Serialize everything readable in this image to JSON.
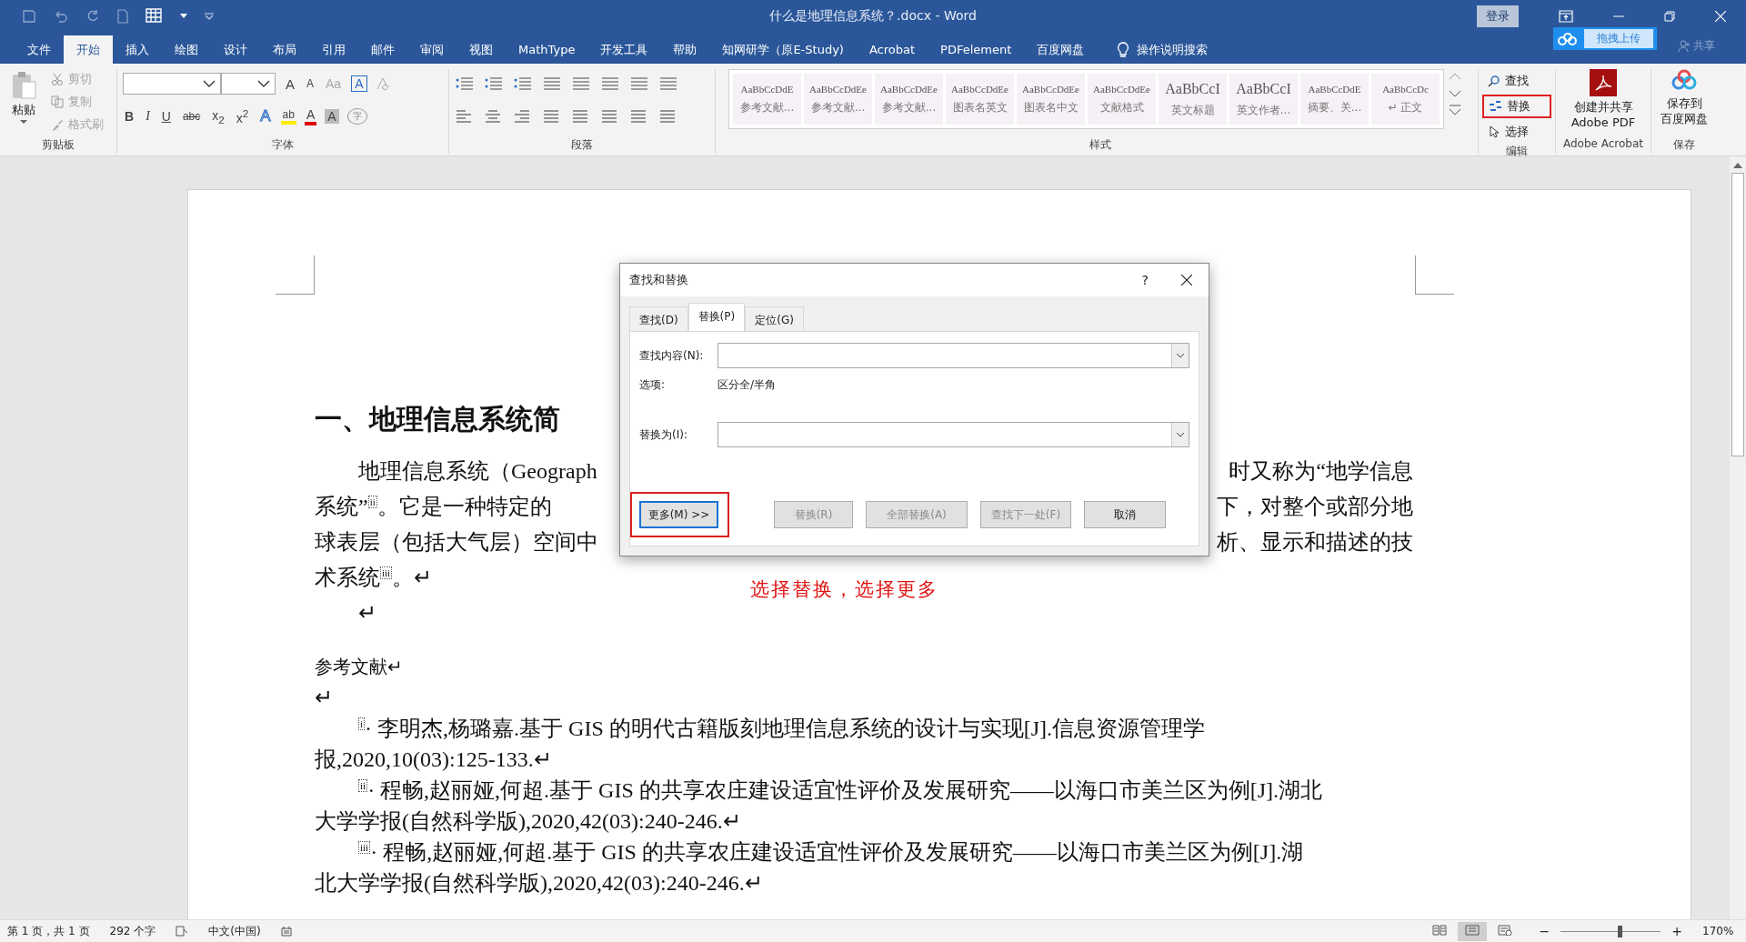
{
  "window": {
    "title": "什么是地理信息系统？.docx  -  Word",
    "login": "登录",
    "upload": "拖拽上传",
    "share": "共享"
  },
  "menu_tabs": [
    {
      "label": "文件",
      "selected": false
    },
    {
      "label": "开始",
      "selected": true
    },
    {
      "label": "插入",
      "selected": false
    },
    {
      "label": "绘图",
      "selected": false
    },
    {
      "label": "设计",
      "selected": false
    },
    {
      "label": "布局",
      "selected": false
    },
    {
      "label": "引用",
      "selected": false
    },
    {
      "label": "邮件",
      "selected": false
    },
    {
      "label": "审阅",
      "selected": false
    },
    {
      "label": "视图",
      "selected": false
    },
    {
      "label": "MathType",
      "selected": false
    },
    {
      "label": "开发工具",
      "selected": false
    },
    {
      "label": "帮助",
      "selected": false
    },
    {
      "label": "知网研学（原E-Study)",
      "selected": false
    },
    {
      "label": "Acrobat",
      "selected": false
    },
    {
      "label": "PDFelement",
      "selected": false
    },
    {
      "label": "百度网盘",
      "selected": false
    }
  ],
  "tell_me": "操作说明搜索",
  "ribbon": {
    "clipboard": {
      "paste": "粘贴",
      "label": "剪贴板",
      "items": [
        {
          "label": "剪切",
          "kind": "cut",
          "disabled": true
        },
        {
          "label": "复制",
          "kind": "copy",
          "disabled": true
        },
        {
          "label": "格式刷",
          "kind": "brush",
          "disabled": true
        }
      ]
    },
    "font": {
      "label": "字体",
      "row1": [
        {
          "label": "A",
          "kind": "grow"
        },
        {
          "label": "A",
          "kind": "shrink"
        },
        {
          "label": "Aa",
          "kind": "case"
        },
        {
          "label": "A",
          "kind": "boxed"
        }
      ],
      "row2": [
        {
          "label": "B",
          "kind": "bold"
        },
        {
          "label": "I",
          "kind": "italic"
        },
        {
          "label": "U",
          "kind": "underline"
        },
        {
          "label": "abc",
          "kind": "strike"
        },
        {
          "label": "x$_{2}$",
          "kind": "plain"
        },
        {
          "label": "x$^{2}$",
          "kind": "plain"
        },
        {
          "label": "A",
          "kind": "effect"
        },
        {
          "label": "ab",
          "kind": "highlight"
        },
        {
          "label": "A",
          "kind": "color"
        },
        {
          "label": "A",
          "kind": "shaded"
        },
        {
          "label": "字",
          "kind": "circled"
        }
      ]
    },
    "paragraph": {
      "label": "段落"
    },
    "styles": {
      "label": "样式",
      "tiles": [
        {
          "preview": "AaBbCcDdE",
          "name": "参考文献..."
        },
        {
          "preview": "AaBbCcDdEe",
          "name": "参考文献..."
        },
        {
          "preview": "AaBbCcDdEe",
          "name": "参考文献..."
        },
        {
          "preview": "AaBbCcDdEe",
          "name": "图表名英文"
        },
        {
          "preview": "AaBbCcDdEe",
          "name": "图表名中文"
        },
        {
          "preview": "AaBbCcDdEe",
          "name": "文献格式"
        },
        {
          "preview": "AaBbCcI",
          "name": "英文标题"
        },
        {
          "preview": "AaBbCcI",
          "name": "英文作者..."
        },
        {
          "preview": "AaBbCcDdE",
          "name": "摘要、关..."
        },
        {
          "preview": "AaBbCcDc",
          "name": "↵ 正文"
        }
      ]
    },
    "editing": {
      "label": "编辑",
      "items": [
        {
          "label": "查找",
          "kind": "find",
          "highlighted": false
        },
        {
          "label": "替换",
          "kind": "replace",
          "highlighted": true
        },
        {
          "label": "选择",
          "kind": "select",
          "highlighted": false
        }
      ]
    },
    "acrobat": {
      "button": [
        "创建并共享",
        "Adobe PDF"
      ],
      "label": "Adobe Acrobat"
    },
    "baidu": {
      "button": [
        "保存到",
        "百度网盘"
      ],
      "label": "保存"
    }
  },
  "document": {
    "heading": "一、地理信息系统简",
    "lines": [
      {
        "indent": true,
        "left": [
          {
            "kind": "text",
            "text": "地理信息系统（Geograph"
          }
        ],
        "right": "时又称为“地学信息"
      },
      {
        "indent": false,
        "left": [
          {
            "kind": "text",
            "text": "系统”"
          },
          {
            "kind": "marker",
            "text": "ii"
          },
          {
            "kind": "text",
            "text": "。它是一种特定的"
          }
        ],
        "right": "下，对整个或部分地"
      },
      {
        "indent": false,
        "left": [
          {
            "kind": "text",
            "text": "球表层（包括大气层）空间中"
          }
        ],
        "right": "析、显示和描述的技"
      },
      {
        "indent": false,
        "left": [
          {
            "kind": "text",
            "text": "术系统"
          },
          {
            "kind": "marker",
            "text": "iii"
          },
          {
            "kind": "text",
            "text": "。↵"
          }
        ]
      },
      {
        "indent": true,
        "left": [
          {
            "kind": "text",
            "text": "↵"
          }
        ]
      }
    ],
    "refs_title": "参考文献↵",
    "blank": "↵",
    "refs": [
      {
        "marker": "i",
        "lines": [
          "· 李明杰,杨璐嘉.基于 GIS 的明代古籍版刻地理信息系统的设计与实现[J].信息资源管理学",
          "报,2020,10(03):125-133.↵"
        ]
      },
      {
        "marker": "ii",
        "lines": [
          "· 程畅,赵丽娅,何超.基于 GIS 的共享农庄建设适宜性评价及发展研究——以海口市美兰区为例[J].湖北",
          "大学学报(自然科学版),2020,42(03):240-246.↵"
        ]
      },
      {
        "marker": "iii",
        "lines": [
          "· 程畅,赵丽娅,何超.基于 GIS 的共享农庄建设适宜性评价及发展研究——以海口市美兰区为例[J].湖",
          "北大学学报(自然科学版),2020,42(03):240-246.↵"
        ]
      }
    ]
  },
  "dialog": {
    "title": "查找和替换",
    "help": "?",
    "tabs": [
      {
        "label": "查找(D)",
        "selected": false
      },
      {
        "label": "替换(P)",
        "selected": true
      },
      {
        "label": "定位(G)",
        "selected": false
      }
    ],
    "find_label": "查找内容(N):",
    "options_label": "选项:",
    "options_value": "区分全/半角",
    "replace_label": "替换为(I):",
    "buttons": [
      {
        "label": "更多(M) >>",
        "kind": "more",
        "disabled": false,
        "highlighted": true
      },
      {
        "label": "替换(R)",
        "kind": "action",
        "disabled": true,
        "highlighted": false
      },
      {
        "label": "全部替换(A)",
        "kind": "action",
        "disabled": true,
        "highlighted": false
      },
      {
        "label": "查找下一处(F)",
        "kind": "action",
        "disabled": true,
        "highlighted": false
      },
      {
        "label": "取消",
        "kind": "action",
        "disabled": false,
        "highlighted": false
      }
    ]
  },
  "annotation": "选择替换，选择更多",
  "status_bar": {
    "page": "第 1 页，共 1 页",
    "words": "292 个字",
    "language": "中文(中国)",
    "views": [
      {
        "kind": "read",
        "selected": false
      },
      {
        "kind": "print",
        "selected": true
      },
      {
        "kind": "web",
        "selected": false
      }
    ],
    "zoom": {
      "minus": "−",
      "plus": "+",
      "level": 0.6,
      "value": "170%"
    }
  }
}
